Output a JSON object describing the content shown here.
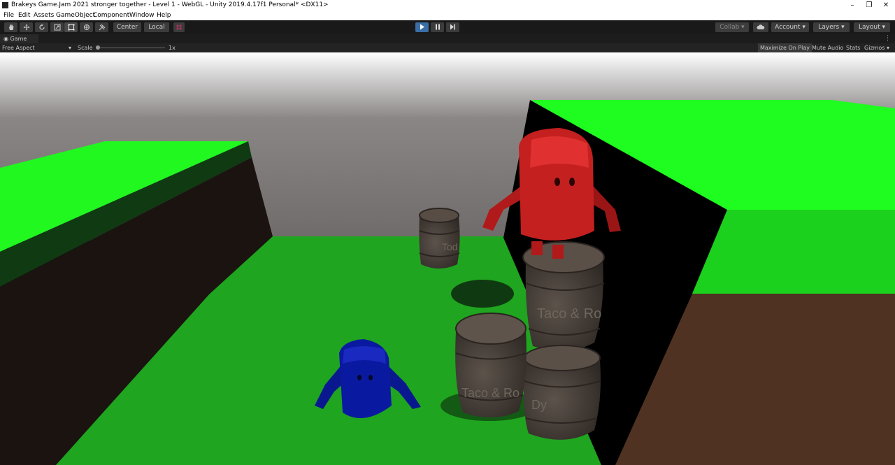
{
  "window": {
    "title": "Brakeys Game.Jam 2021 stronger together - Level 1 - WebGL - Unity 2019.4.17f1 Personal* <DX11>",
    "controls": [
      "minimize-icon",
      "restore-icon",
      "close-icon"
    ]
  },
  "menu": [
    "File",
    "Edit",
    "Assets",
    "GameObject",
    "Component",
    "Window",
    "Help"
  ],
  "toolbar": {
    "tools": [
      "hand-icon",
      "move-icon",
      "rotate-icon",
      "scale-icon",
      "rect-tool-icon",
      "transform-icon",
      "custom-tool-icon"
    ],
    "pivot_mode": "Center",
    "pivot_rotation": "Local",
    "playback": [
      "play-icon",
      "pause-icon",
      "step-icon"
    ],
    "collab": "Collab",
    "account": "Account",
    "layers": "Layers",
    "layout": "Layout"
  },
  "game_view": {
    "tab_label": "Game",
    "aspect": "Free Aspect",
    "scale_label": "Scale",
    "scale_value": "1x",
    "maximize_on_play": "Maximize On Play",
    "mute_audio": "Mute Audio",
    "stats": "Stats",
    "gizmos": "Gizmos"
  },
  "scene": {
    "barrel_label_top": "Tod",
    "barrel_label_right": "Taco & Ro",
    "barrel_label_front": "Taco & Ro",
    "barrel_label_bottom": "Dy",
    "colors": {
      "sky": "#747170",
      "grass": "#1fa51f",
      "bright_grass": "#22ff22",
      "red_character": "#c4201f",
      "blue_character": "#0a1aa0",
      "dirt": "#4f3222",
      "barrel": "#4b433c"
    }
  }
}
